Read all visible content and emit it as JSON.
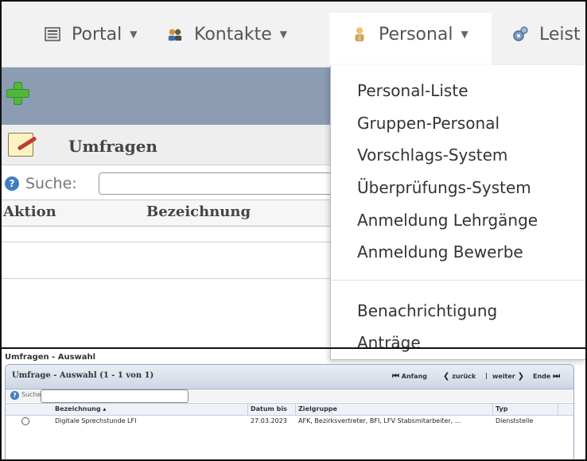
{
  "nav": {
    "items": [
      {
        "label": "Portal",
        "icon": "portal-icon"
      },
      {
        "label": "Kontakte",
        "icon": "contacts-icon"
      },
      {
        "label": "Personal",
        "icon": "personal-icon"
      },
      {
        "label": "Leist",
        "icon": "gear-icon"
      }
    ]
  },
  "panel": {
    "title": "Umfragen",
    "search_label": "Suche:",
    "search_value": "",
    "columns": [
      "Aktion",
      "Bezeichnung"
    ]
  },
  "dropdown": {
    "items": [
      "Personal-Liste",
      "Gruppen-Personal",
      "Vorschlags-System",
      "Überprüfungs-System",
      "Anmeldung Lehrgänge",
      "Anmeldung Bewerbe",
      "Benachrichtigung",
      "Anträge"
    ]
  },
  "dialog": {
    "legend": "Umfragen - Auswahl",
    "title": "Umfrage - Auswahl (1 - 1 von 1)",
    "pager": {
      "first": "Anfang",
      "prev": "zurück",
      "sep": "|",
      "next": "weiter",
      "last": "Ende"
    },
    "search_label": "Suche:",
    "columns": [
      "Bezeichnung ▴",
      "Datum bis",
      "Zielgruppe",
      "Typ"
    ],
    "rows": [
      {
        "bezeichnung": "Digitale Sprechstunde LFI",
        "datum": "27.03.2023",
        "zielgruppe": "AFK, Bezirksvertreter, BFI, LFV Stabsmitarbeiter, ...",
        "typ": "Dienststelle"
      }
    ]
  },
  "colors": {
    "toolbar": "#8c9db3",
    "plus": "#4fb83a",
    "accent": "#3f7fc0"
  }
}
